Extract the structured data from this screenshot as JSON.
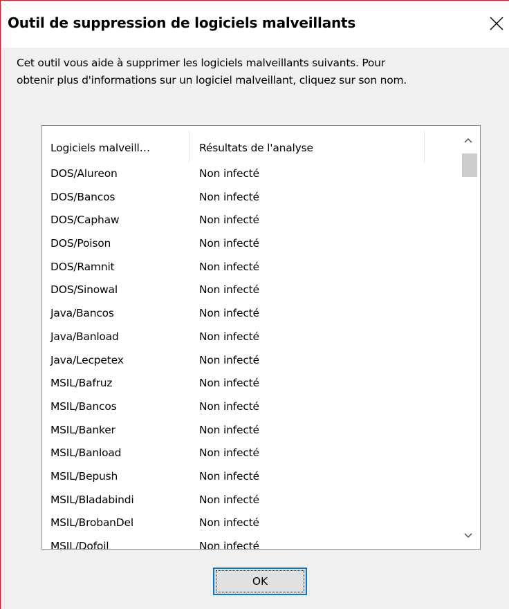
{
  "window": {
    "title": "Outil de suppression de logiciels malveillants",
    "close_symbol": "×"
  },
  "description": {
    "line1": "Cet outil vous aide à supprimer les logiciels malveillants suivants. Pour",
    "line2": "obtenir plus d'informations sur un logiciel malveillant, cliquez sur son nom."
  },
  "list": {
    "columns": [
      "Logiciels malveill…",
      "Résultats de l'analyse"
    ],
    "rows": [
      {
        "name": "DOS/Alureon",
        "result": "Non infecté"
      },
      {
        "name": "DOS/Bancos",
        "result": "Non infecté"
      },
      {
        "name": "DOS/Caphaw",
        "result": "Non infecté"
      },
      {
        "name": "DOS/Poison",
        "result": "Non infecté"
      },
      {
        "name": "DOS/Ramnit",
        "result": "Non infecté"
      },
      {
        "name": "DOS/Sinowal",
        "result": "Non infecté"
      },
      {
        "name": "Java/Bancos",
        "result": "Non infecté"
      },
      {
        "name": "Java/Banload",
        "result": "Non infecté"
      },
      {
        "name": "Java/Lecpetex",
        "result": "Non infecté"
      },
      {
        "name": "MSIL/Bafruz",
        "result": "Non infecté"
      },
      {
        "name": "MSIL/Bancos",
        "result": "Non infecté"
      },
      {
        "name": "MSIL/Banker",
        "result": "Non infecté"
      },
      {
        "name": "MSIL/Banload",
        "result": "Non infecté"
      },
      {
        "name": "MSIL/Bepush",
        "result": "Non infecté"
      },
      {
        "name": "MSIL/Bladabindi",
        "result": "Non infecté"
      },
      {
        "name": "MSIL/BrobanDel",
        "result": "Non infecté"
      },
      {
        "name": "MSIL/Dofoil",
        "result": "Non infecté"
      }
    ]
  },
  "buttons": {
    "ok_label": "OK"
  },
  "icons": {
    "close": "close-icon",
    "scroll_up": "chevron-up-icon",
    "scroll_down": "chevron-down-icon"
  },
  "colors": {
    "window_border": "#e81123",
    "accent_focus": "#0078d7"
  }
}
